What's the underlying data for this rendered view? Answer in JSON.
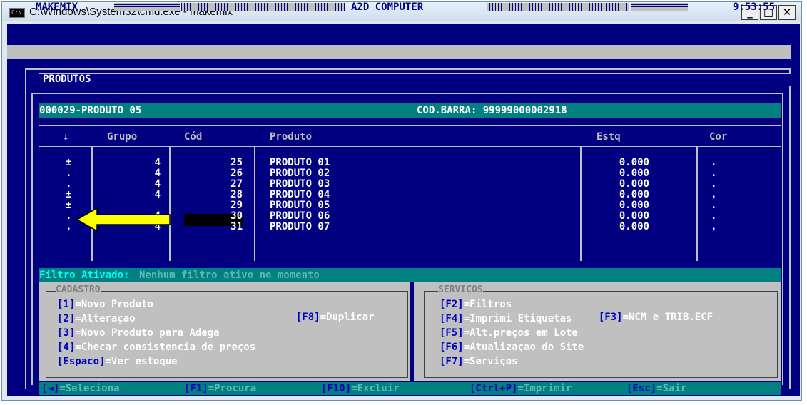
{
  "window": {
    "title": "C:\\Windows\\System32\\cmd.exe - makemix",
    "icon_label": "C:\\",
    "buttons": [
      "_",
      "□",
      "✕"
    ]
  },
  "statusbar": {
    "app": "MAKEMIX",
    "company": "A2D COMPUTER",
    "time": "9:53:55"
  },
  "screen": {
    "title": "PRODUTOS",
    "current": "000029-PRODUTO 05",
    "barcode": "COD.BARRA: 99999000002918"
  },
  "table": {
    "headers": [
      "↓",
      "Grupo",
      "Cód",
      "Produto",
      "Estq",
      "Cor"
    ],
    "rows": [
      {
        "mark": "±",
        "grupo": "4",
        "cod": "25",
        "produto": "PRODUTO 01",
        "estq": "0.000",
        "cor": "."
      },
      {
        "mark": ".",
        "grupo": "4",
        "cod": "26",
        "produto": "PRODUTO 02",
        "estq": "0.000",
        "cor": "."
      },
      {
        "mark": ".",
        "grupo": "4",
        "cod": "27",
        "produto": "PRODUTO 03",
        "estq": "0.000",
        "cor": "."
      },
      {
        "mark": "±",
        "grupo": "4",
        "cod": "28",
        "produto": "PRODUTO 04",
        "estq": "0.000",
        "cor": "."
      },
      {
        "mark": "±",
        "grupo": "",
        "cod": "29",
        "produto": "PRODUTO 05",
        "estq": "0.000",
        "cor": "."
      },
      {
        "mark": ".",
        "grupo": "4",
        "cod": "30",
        "produto": "PRODUTO 06",
        "estq": "0.000",
        "cor": "."
      },
      {
        "mark": ".",
        "grupo": "4",
        "cod": "31",
        "produto": "PRODUTO 07",
        "estq": "0.000",
        "cor": "."
      }
    ]
  },
  "filter": {
    "label": "Filtro Ativado:",
    "value": "Nenhum filtro ativo no momento"
  },
  "cadastro": {
    "title": "CADASTRO",
    "items": [
      {
        "key": "[1]",
        "label": "=Novo Produto"
      },
      {
        "key": "[2]",
        "label": "=Alteraçao"
      },
      {
        "key": "[3]",
        "label": "=Novo Produto para Adega"
      },
      {
        "key": "[4]",
        "label": "=Checar consistencia de preços"
      },
      {
        "key": "[Espaco]",
        "label": "=Ver estoque"
      }
    ],
    "extra": {
      "key": "[F8]",
      "label": "=Duplicar"
    }
  },
  "servicos": {
    "title": "SERVIÇOS",
    "items": [
      {
        "key": "[F2]",
        "label": "=Filtros"
      },
      {
        "key": "[F4]",
        "label": "=Imprimi Etiquetas"
      },
      {
        "key": "[F5]",
        "label": "=Alt.preços em Lote"
      },
      {
        "key": "[F6]",
        "label": "=Atualizaçao do Site"
      },
      {
        "key": "[F7]",
        "label": "=Serviços"
      }
    ],
    "extra": {
      "key": "[F3]",
      "label": "=NCM e TRIB.ECF"
    }
  },
  "footer": [
    {
      "key": "[◄]",
      "label": "=Seleciona"
    },
    {
      "key": "[F1]",
      "label": "=Procura"
    },
    {
      "key": "[F10]",
      "label": "=Excluir"
    },
    {
      "key": "[Ctrl+P]",
      "label": "=Imprimir"
    },
    {
      "key": "[Esc]",
      "label": "=Sair"
    }
  ],
  "colors": {
    "background": "#000080",
    "panel": "#c0c0c0",
    "teal": "#008080",
    "arrow": "#ffff00",
    "key": "#0000c0",
    "filter_label": "#00ffff"
  }
}
